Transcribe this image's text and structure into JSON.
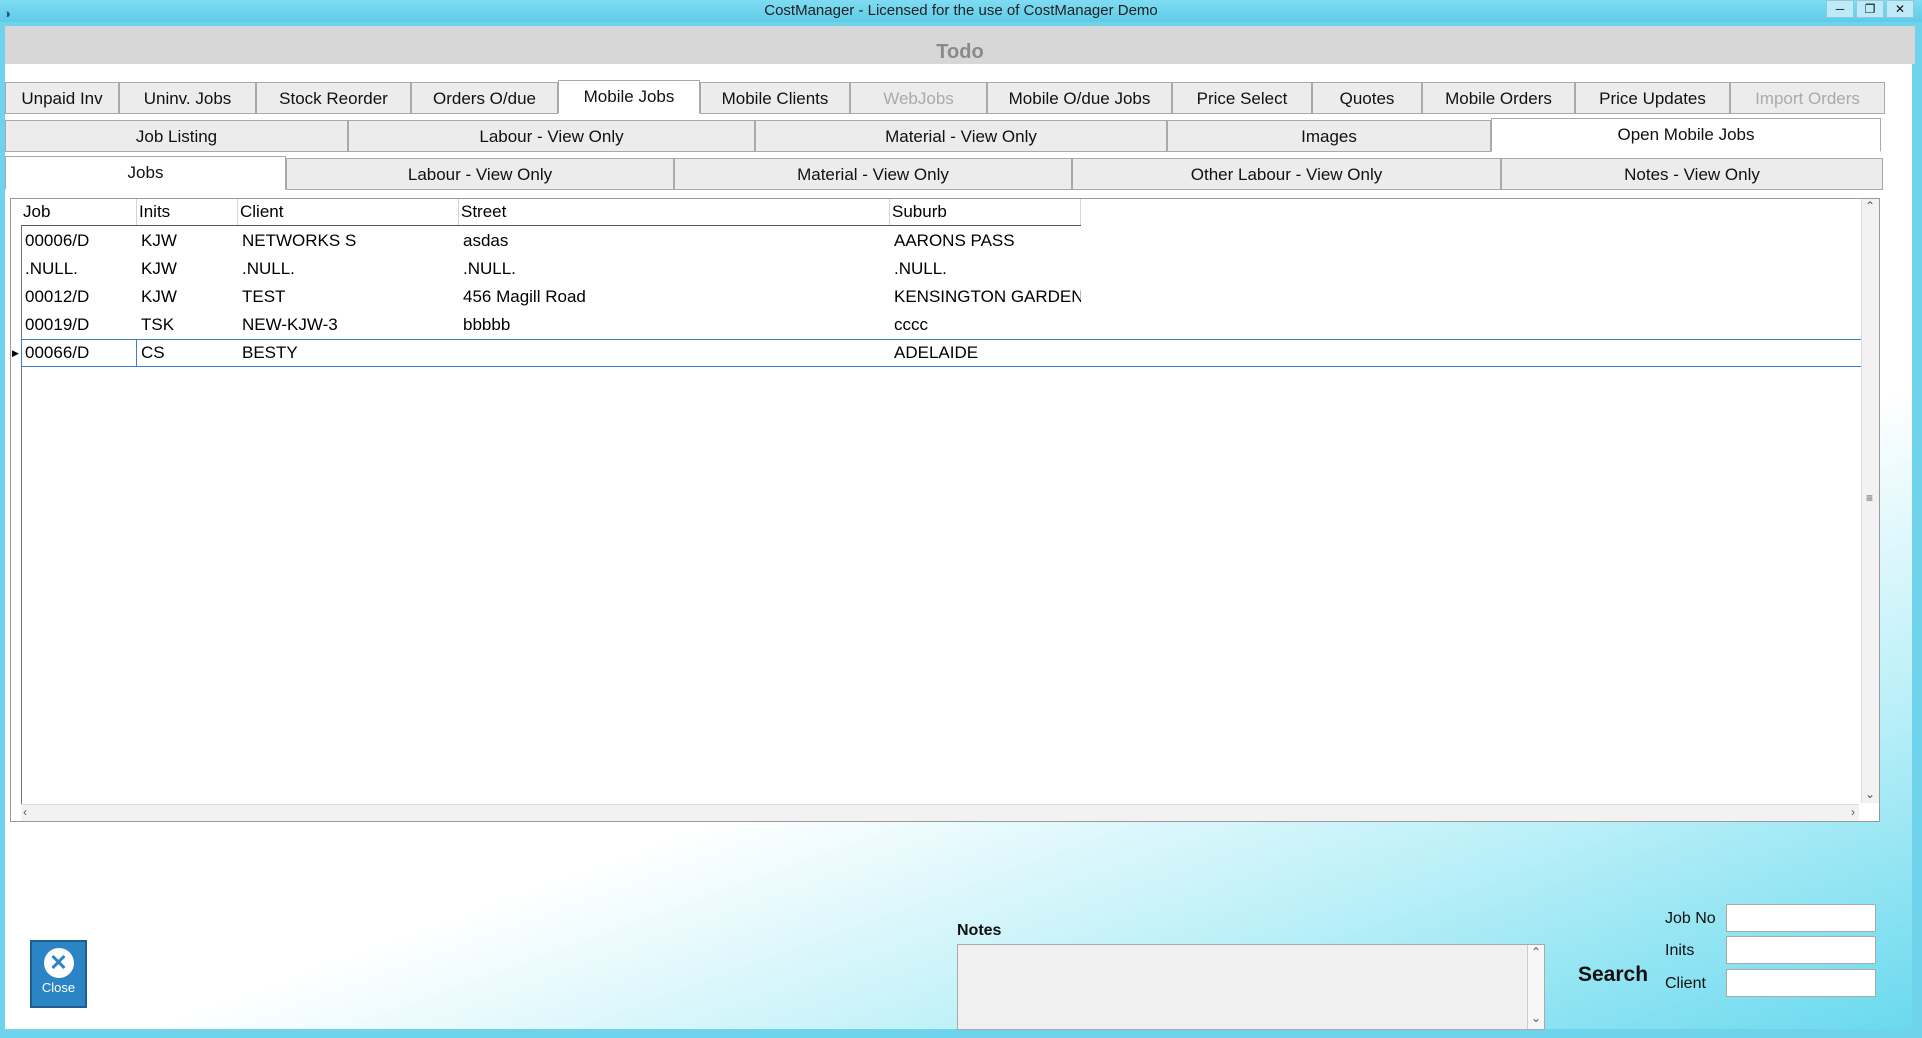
{
  "window": {
    "title": "CostManager - Licensed for the use of CostManager Demo",
    "buttons": [
      "minimize",
      "restore",
      "close"
    ]
  },
  "header": {
    "title": "Todo"
  },
  "main_tabs": [
    {
      "label": "Unpaid Inv",
      "state": "normal"
    },
    {
      "label": "Uninv. Jobs",
      "state": "normal"
    },
    {
      "label": "Stock Reorder",
      "state": "normal"
    },
    {
      "label": "Orders O/due",
      "state": "normal"
    },
    {
      "label": "Mobile Jobs",
      "state": "active"
    },
    {
      "label": "Mobile Clients",
      "state": "normal"
    },
    {
      "label": "WebJobs",
      "state": "disabled"
    },
    {
      "label": "Mobile O/due Jobs",
      "state": "normal"
    },
    {
      "label": "Price Select",
      "state": "normal"
    },
    {
      "label": "Quotes",
      "state": "normal"
    },
    {
      "label": "Mobile Orders",
      "state": "normal"
    },
    {
      "label": "Price Updates",
      "state": "normal"
    },
    {
      "label": "Import Orders",
      "state": "disabled"
    }
  ],
  "sub_tabs": [
    {
      "label": "Job Listing",
      "state": "normal"
    },
    {
      "label": "Labour - View Only",
      "state": "normal"
    },
    {
      "label": "Material - View Only",
      "state": "normal"
    },
    {
      "label": "Images",
      "state": "normal"
    },
    {
      "label": "Open Mobile Jobs",
      "state": "active"
    }
  ],
  "detail_tabs": [
    {
      "label": "Jobs",
      "state": "active"
    },
    {
      "label": "Labour - View Only",
      "state": "normal"
    },
    {
      "label": "Material - View Only",
      "state": "normal"
    },
    {
      "label": "Other Labour - View Only",
      "state": "normal"
    },
    {
      "label": "Notes - View Only",
      "state": "normal"
    }
  ],
  "grid": {
    "columns": [
      "Job",
      "Inits",
      "Client",
      "Street",
      "Suburb"
    ],
    "rows": [
      [
        "00006/D",
        "KJW",
        "NETWORKS S",
        "asdas",
        "AARONS PASS"
      ],
      [
        ".NULL.",
        "KJW",
        ".NULL.",
        ".NULL.",
        ".NULL."
      ],
      [
        "00012/D",
        "KJW",
        "TEST",
        "456 Magill Road",
        "KENSINGTON GARDEN"
      ],
      [
        "00019/D",
        "TSK",
        "NEW-KJW-3",
        "bbbbb",
        "cccc"
      ],
      [
        "00066/D",
        "CS",
        "BESTY",
        "",
        "ADELAIDE"
      ]
    ],
    "selected_row": 4
  },
  "close_button": {
    "label": "Close",
    "icon": "close-x-icon"
  },
  "notes": {
    "label": "Notes",
    "value": ""
  },
  "search": {
    "label": "Search",
    "fields": [
      {
        "label": "Job No",
        "value": ""
      },
      {
        "label": "Inits",
        "value": ""
      },
      {
        "label": "Client",
        "value": ""
      }
    ]
  },
  "colors": {
    "accent": "#2b84c5",
    "titlebar": "#5fcbe7",
    "selection": "#3a7fd0"
  }
}
